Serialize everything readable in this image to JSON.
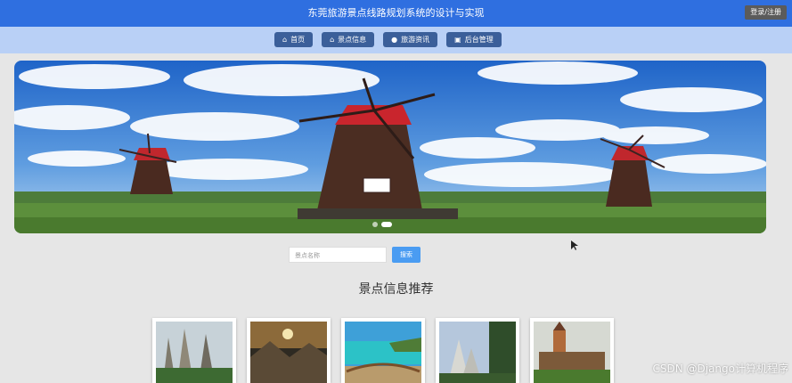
{
  "header": {
    "title": "东莞旅游景点线路规划系统的设计与实现",
    "login_label": "登录/注册"
  },
  "nav": {
    "items": [
      {
        "label": "首页",
        "icon": "home-icon"
      },
      {
        "label": "景点信息",
        "icon": "home-icon"
      },
      {
        "label": "旅游资讯",
        "icon": "circle-icon"
      },
      {
        "label": "后台管理",
        "icon": "monitor-icon"
      }
    ]
  },
  "banner": {
    "slide_count": 2,
    "active_index": 1
  },
  "search": {
    "placeholder": "景点名称",
    "button_label": "搜索"
  },
  "recommend": {
    "title": "景点信息推荐",
    "cards": [
      {
        "icon": "karst-peaks-image"
      },
      {
        "icon": "sunset-mountain-image"
      },
      {
        "icon": "beach-bridge-image"
      },
      {
        "icon": "cliff-tree-image"
      },
      {
        "icon": "village-tower-image"
      }
    ]
  },
  "watermark": "CSDN @Django计算机程序"
}
